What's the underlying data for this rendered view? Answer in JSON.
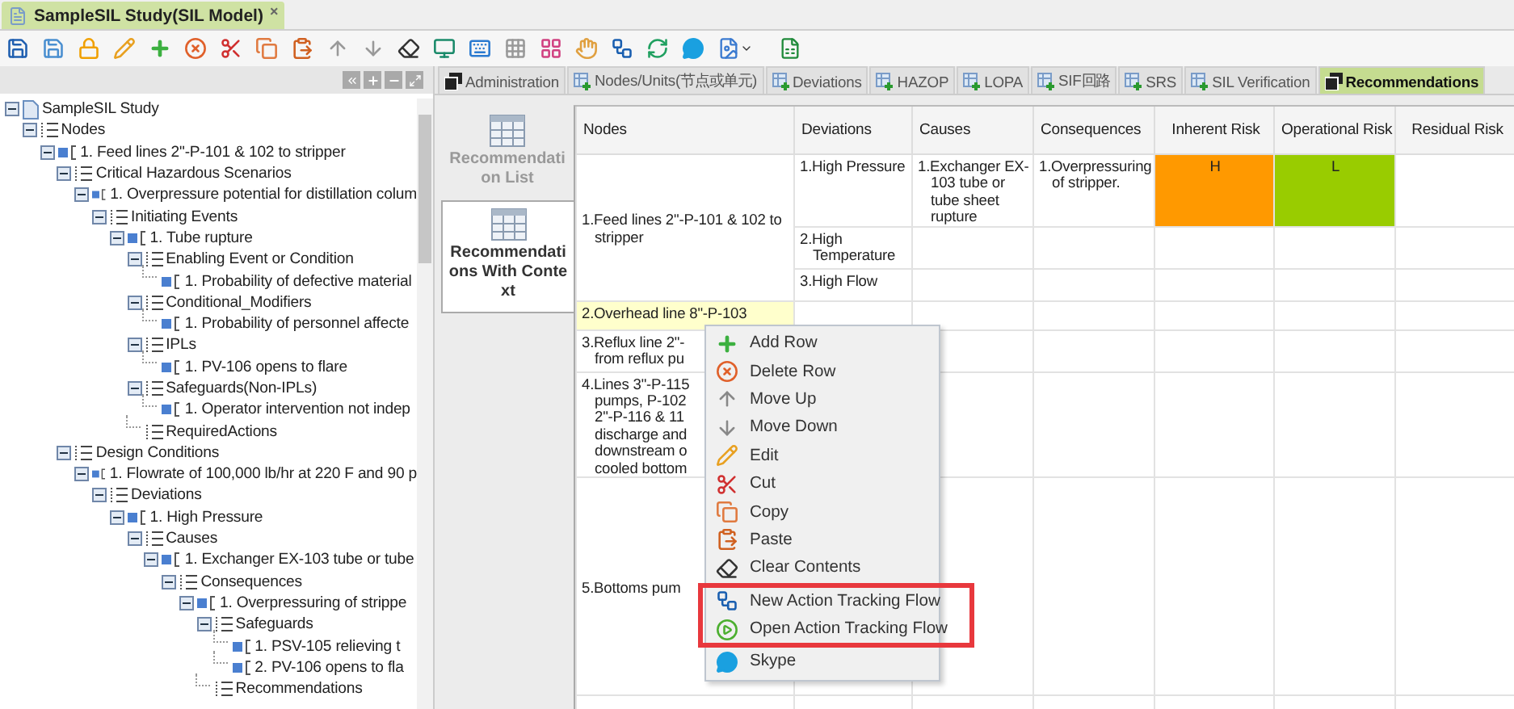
{
  "document_tab": {
    "title": "SampleSIL Study(SIL Model)",
    "close": "×",
    "selected": true
  },
  "tree": {
    "items": [
      {
        "label": "SampleSIL Study",
        "kind": "root",
        "expanded": true,
        "children": [
          {
            "label": "Nodes",
            "kind": "group",
            "expanded": true,
            "children": [
              {
                "label": "1. Feed lines 2\"-P-101 & 102 to stripper",
                "kind": "item",
                "expanded": true,
                "children": [
                  {
                    "label": "Critical Hazardous Scenarios",
                    "kind": "group",
                    "expanded": true,
                    "children": [
                      {
                        "label": "1. Overpressure potential for distillation colum",
                        "kind": "item",
                        "expanded": true,
                        "children": [
                          {
                            "label": "Initiating Events",
                            "kind": "group",
                            "expanded": true,
                            "children": [
                              {
                                "label": "1. Tube rupture",
                                "kind": "item",
                                "expanded": true,
                                "children": [
                                  {
                                    "label": "Enabling Event or Condition",
                                    "kind": "group",
                                    "expanded": true,
                                    "children": [
                                      {
                                        "label": "1. Probability of defective material",
                                        "kind": "item"
                                      }
                                    ]
                                  },
                                  {
                                    "label": "Conditional_Modifiers",
                                    "kind": "group",
                                    "expanded": true,
                                    "children": [
                                      {
                                        "label": "1. Probability of personnel affecte",
                                        "kind": "item"
                                      }
                                    ]
                                  },
                                  {
                                    "label": "IPLs",
                                    "kind": "group",
                                    "expanded": true,
                                    "children": [
                                      {
                                        "label": "1. PV-106 opens to flare",
                                        "kind": "item"
                                      }
                                    ]
                                  },
                                  {
                                    "label": "Safeguards(Non-IPLs)",
                                    "kind": "group",
                                    "expanded": true,
                                    "children": [
                                      {
                                        "label": "1. Operator intervention not indep",
                                        "kind": "item"
                                      }
                                    ]
                                  },
                                  {
                                    "label": "RequiredActions",
                                    "kind": "group"
                                  }
                                ]
                              }
                            ]
                          }
                        ]
                      }
                    ]
                  },
                  {
                    "label": "Design Conditions",
                    "kind": "group",
                    "expanded": true,
                    "children": [
                      {
                        "label": "1. Flowrate of 100,000 lb/hr at 220 F and 90 p",
                        "kind": "item",
                        "expanded": true,
                        "children": [
                          {
                            "label": "Deviations",
                            "kind": "group",
                            "expanded": true,
                            "children": [
                              {
                                "label": "1. High Pressure",
                                "kind": "item",
                                "expanded": true,
                                "children": [
                                  {
                                    "label": "Causes",
                                    "kind": "group",
                                    "expanded": true,
                                    "children": [
                                      {
                                        "label": "1. Exchanger EX-103 tube or tube",
                                        "kind": "item",
                                        "expanded": true,
                                        "children": [
                                          {
                                            "label": "Consequences",
                                            "kind": "group",
                                            "expanded": true,
                                            "children": [
                                              {
                                                "label": "1. Overpressuring of strippe",
                                                "kind": "item",
                                                "expanded": true,
                                                "children": [
                                                  {
                                                    "label": "Safeguards",
                                                    "kind": "group",
                                                    "expanded": true,
                                                    "children": [
                                                      {
                                                        "label": "1. PSV-105 relieving t",
                                                        "kind": "item"
                                                      },
                                                      {
                                                        "label": "2. PV-106 opens to fla",
                                                        "kind": "item"
                                                      }
                                                    ]
                                                  },
                                                  {
                                                    "label": "Recommendations",
                                                    "kind": "group"
                                                  }
                                                ]
                                              }
                                            ]
                                          }
                                        ]
                                      }
                                    ]
                                  }
                                ]
                              }
                            ]
                          }
                        ]
                      }
                    ]
                  }
                ]
              }
            ]
          }
        ]
      }
    ]
  },
  "tabs": [
    {
      "label": "Administration",
      "kind": "window",
      "selected": false
    },
    {
      "label": "Nodes/Units(节点或单元)",
      "kind": "grid",
      "selected": false
    },
    {
      "label": "Deviations",
      "kind": "grid",
      "selected": false
    },
    {
      "label": "HAZOP",
      "kind": "grid",
      "selected": false
    },
    {
      "label": "LOPA",
      "kind": "grid",
      "selected": false
    },
    {
      "label": "SIF回路",
      "kind": "grid",
      "selected": false
    },
    {
      "label": "SRS",
      "kind": "grid",
      "selected": false
    },
    {
      "label": "SIL Verification",
      "kind": "grid",
      "selected": false
    },
    {
      "label": "Recommendations",
      "kind": "window",
      "selected": true
    }
  ],
  "side_tabs": [
    {
      "label": "Recommendation List",
      "selected": false
    },
    {
      "label": "Recommendations With Context",
      "selected": true
    }
  ],
  "table": {
    "columns": [
      "Nodes",
      "Deviations",
      "Causes",
      "Consequences",
      "Inherent Risk",
      "Operational Risk",
      "Residual Risk"
    ],
    "rows": [
      {
        "node": "1.Feed lines 2\"-P-101 & 102 to stripper",
        "selected": false,
        "deviations": [
          {
            "deviation": "1.High Pressure",
            "cause": "1.Exchanger EX-103 tube or tube sheet rupture",
            "consequence": "1.Overpressuring of stripper.",
            "inherent_risk": {
              "text": "H",
              "color": "#ff9900"
            },
            "operational_risk": {
              "text": "L",
              "color": "#99cc00"
            }
          },
          {
            "deviation": "2.High Temperature"
          },
          {
            "deviation": "3.High Flow"
          }
        ]
      },
      {
        "node": "2.Overhead line 8\"-P-103",
        "selected": true
      },
      {
        "node": "3.Reflux line 2\"-\nfrom reflux pu",
        "selected": false
      },
      {
        "node": "4.Lines 3\"-P-115\npumps, P-102\n2\"-P-116 & 11\ndischarge and\ndownstream o\ncooled bottom",
        "selected": false
      },
      {
        "node": "5.Bottoms pum",
        "selected": false
      }
    ]
  },
  "context_menu": {
    "items": [
      {
        "label": "Add Row",
        "highlighted": false
      },
      {
        "label": "Delete Row",
        "highlighted": false
      },
      {
        "label": "Move Up",
        "highlighted": false
      },
      {
        "label": "Move Down",
        "highlighted": false
      },
      {
        "label": "Edit",
        "highlighted": false
      },
      {
        "label": "Cut",
        "highlighted": false
      },
      {
        "label": "Copy",
        "highlighted": false
      },
      {
        "label": "Paste",
        "highlighted": false
      },
      {
        "label": "Clear Contents",
        "highlighted": false
      },
      {
        "label": "New Action Tracking Flow",
        "highlighted": true
      },
      {
        "label": "Open Action Tracking Flow",
        "highlighted": true
      },
      {
        "label": "Skype",
        "highlighted": false
      }
    ]
  }
}
